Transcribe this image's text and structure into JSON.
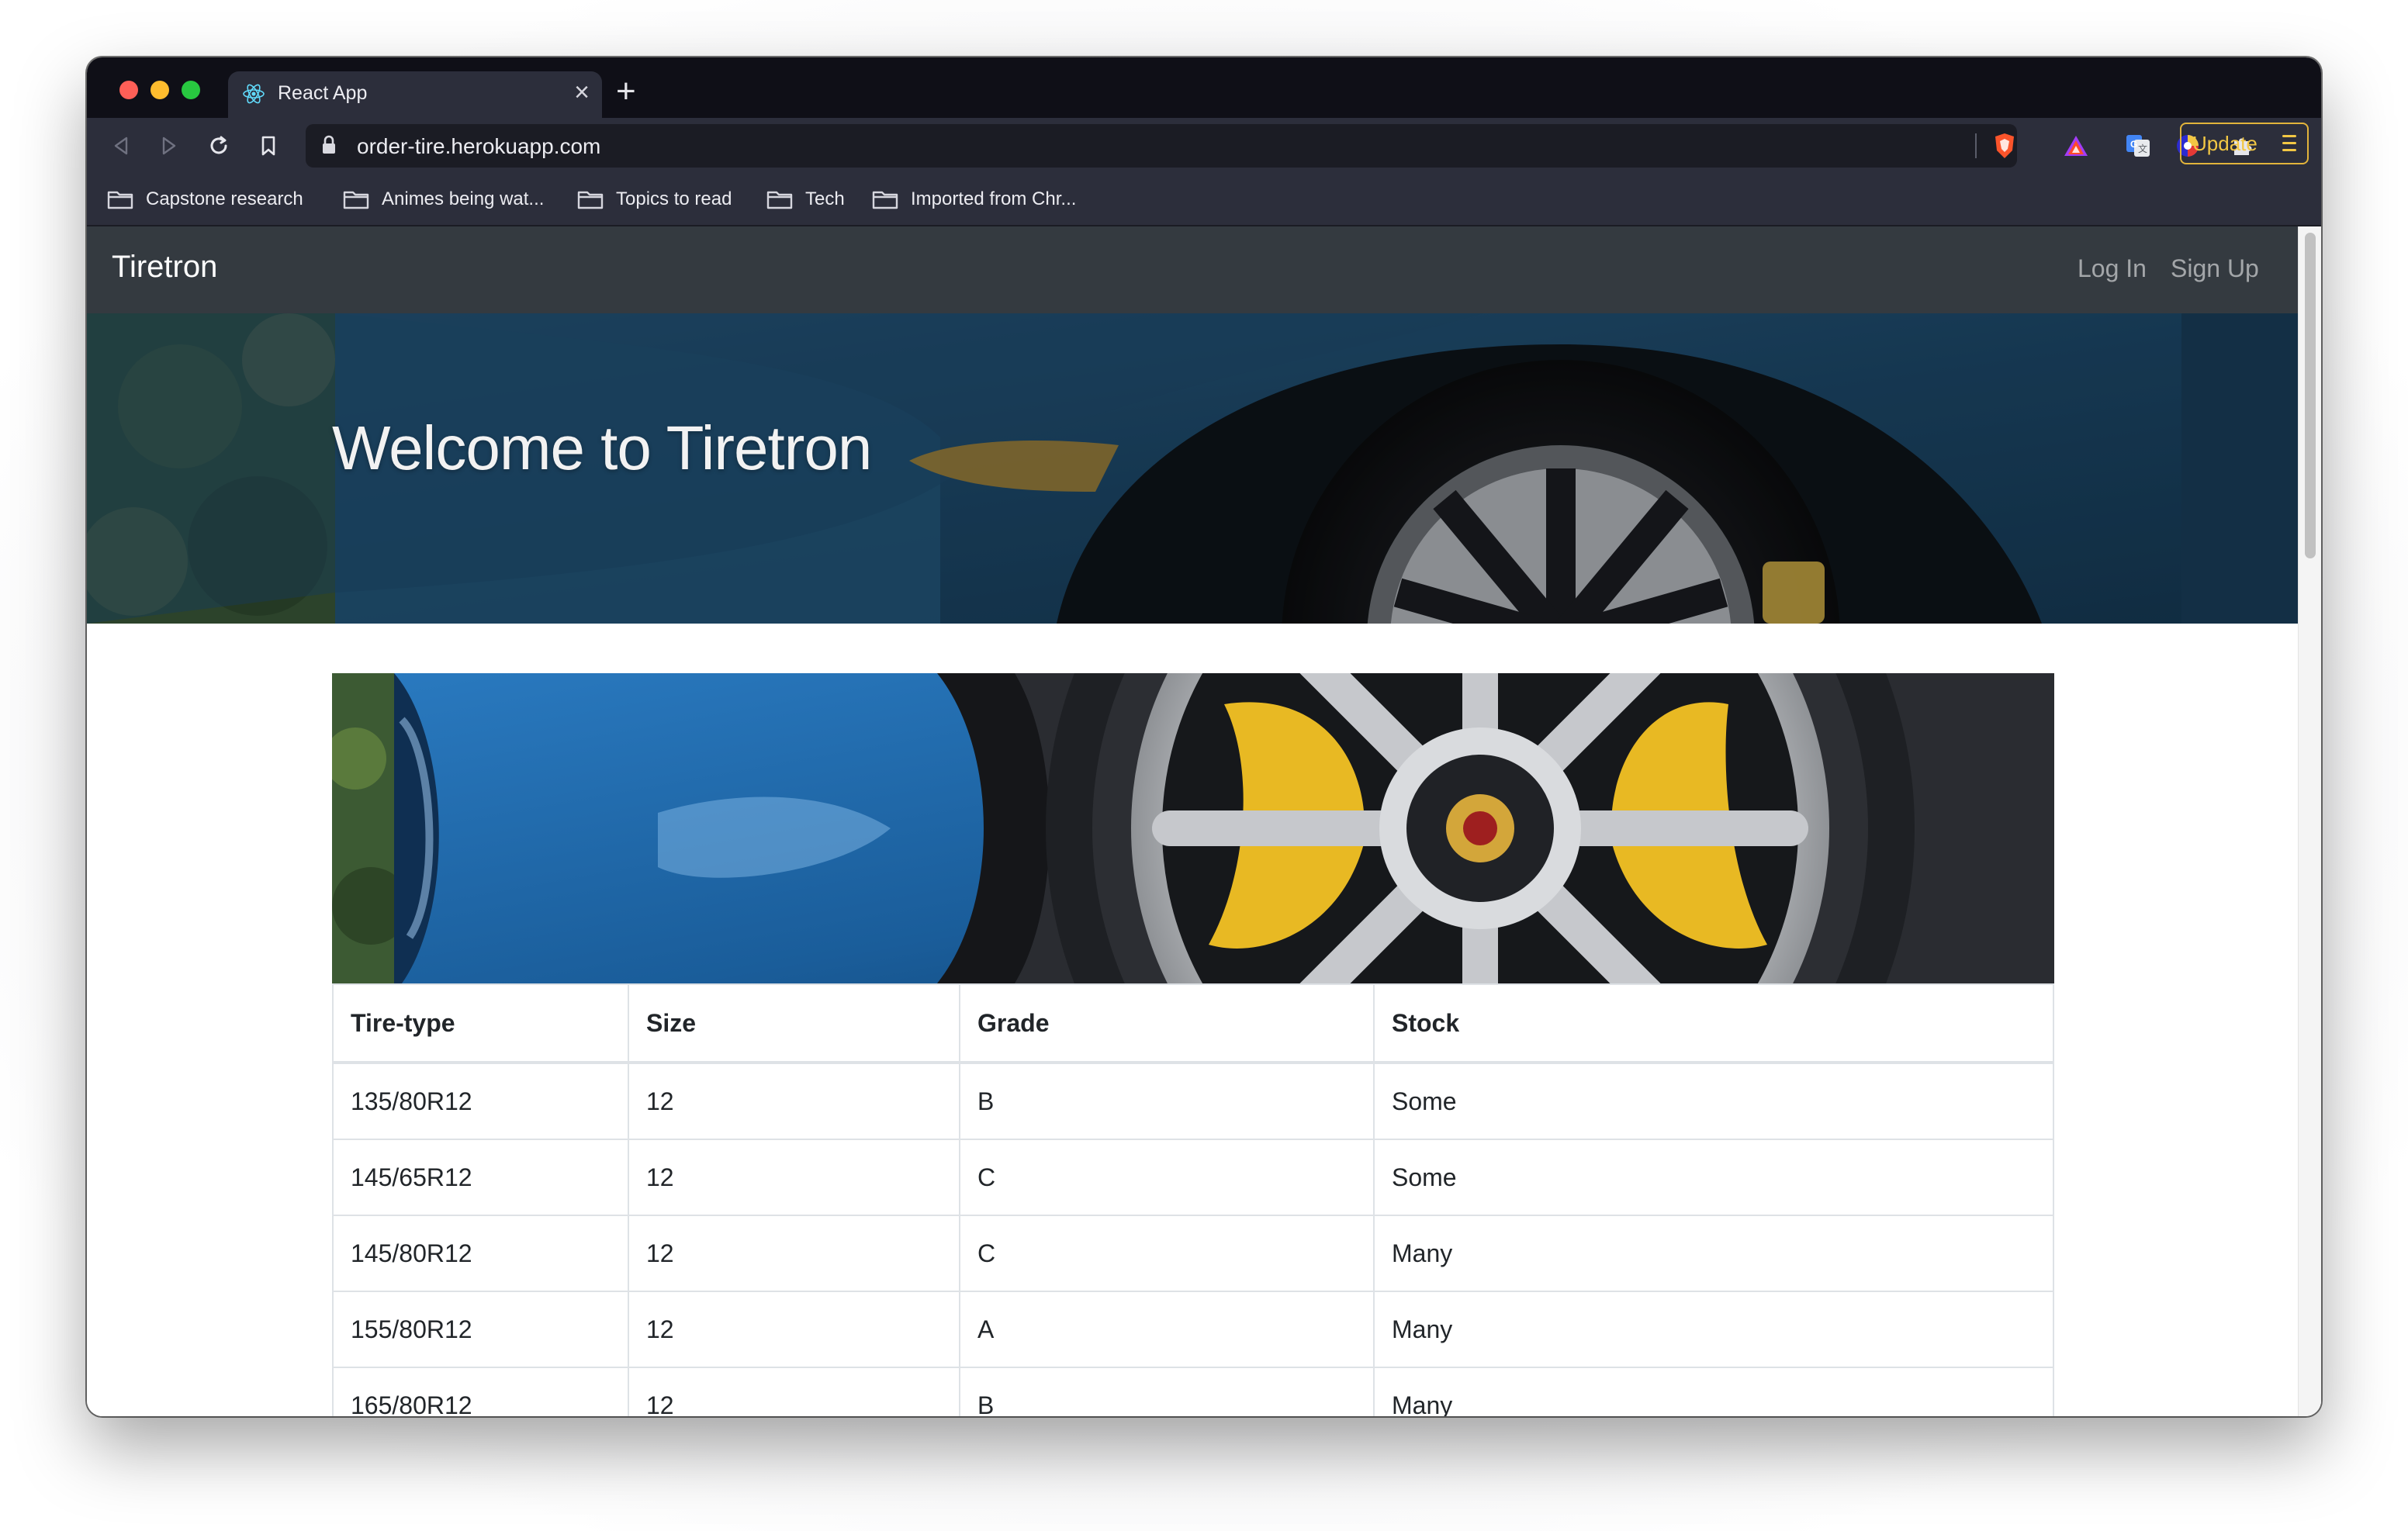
{
  "browser": {
    "tab_title": "React App",
    "new_tab_symbol": "+",
    "url": "order-tire.herokuapp.com",
    "update_label": "Update",
    "bookmarks": [
      {
        "label": "Capstone research"
      },
      {
        "label": "Animes being wat..."
      },
      {
        "label": "Topics to read"
      },
      {
        "label": "Tech"
      },
      {
        "label": "Imported from Chr..."
      }
    ]
  },
  "navbar": {
    "brand": "Tiretron",
    "login_label": "Log In",
    "signup_label": "Sign Up"
  },
  "hero": {
    "title": "Welcome to Tiretron"
  },
  "table": {
    "headers": [
      "Tire-type",
      "Size",
      "Grade",
      "Stock"
    ],
    "rows": [
      [
        "135/80R12",
        "12",
        "B",
        "Some"
      ],
      [
        "145/65R12",
        "12",
        "C",
        "Some"
      ],
      [
        "145/80R12",
        "12",
        "C",
        "Many"
      ],
      [
        "155/80R12",
        "12",
        "A",
        "Many"
      ],
      [
        "165/80R12",
        "12",
        "B",
        "Many"
      ]
    ]
  },
  "colors": {
    "navbar_bg": "#343a40",
    "browser_chrome": "#2c2e3b",
    "update_accent": "#e2b43b",
    "car_blue": "#1f5f94",
    "caliper_yellow": "#e8b923"
  }
}
